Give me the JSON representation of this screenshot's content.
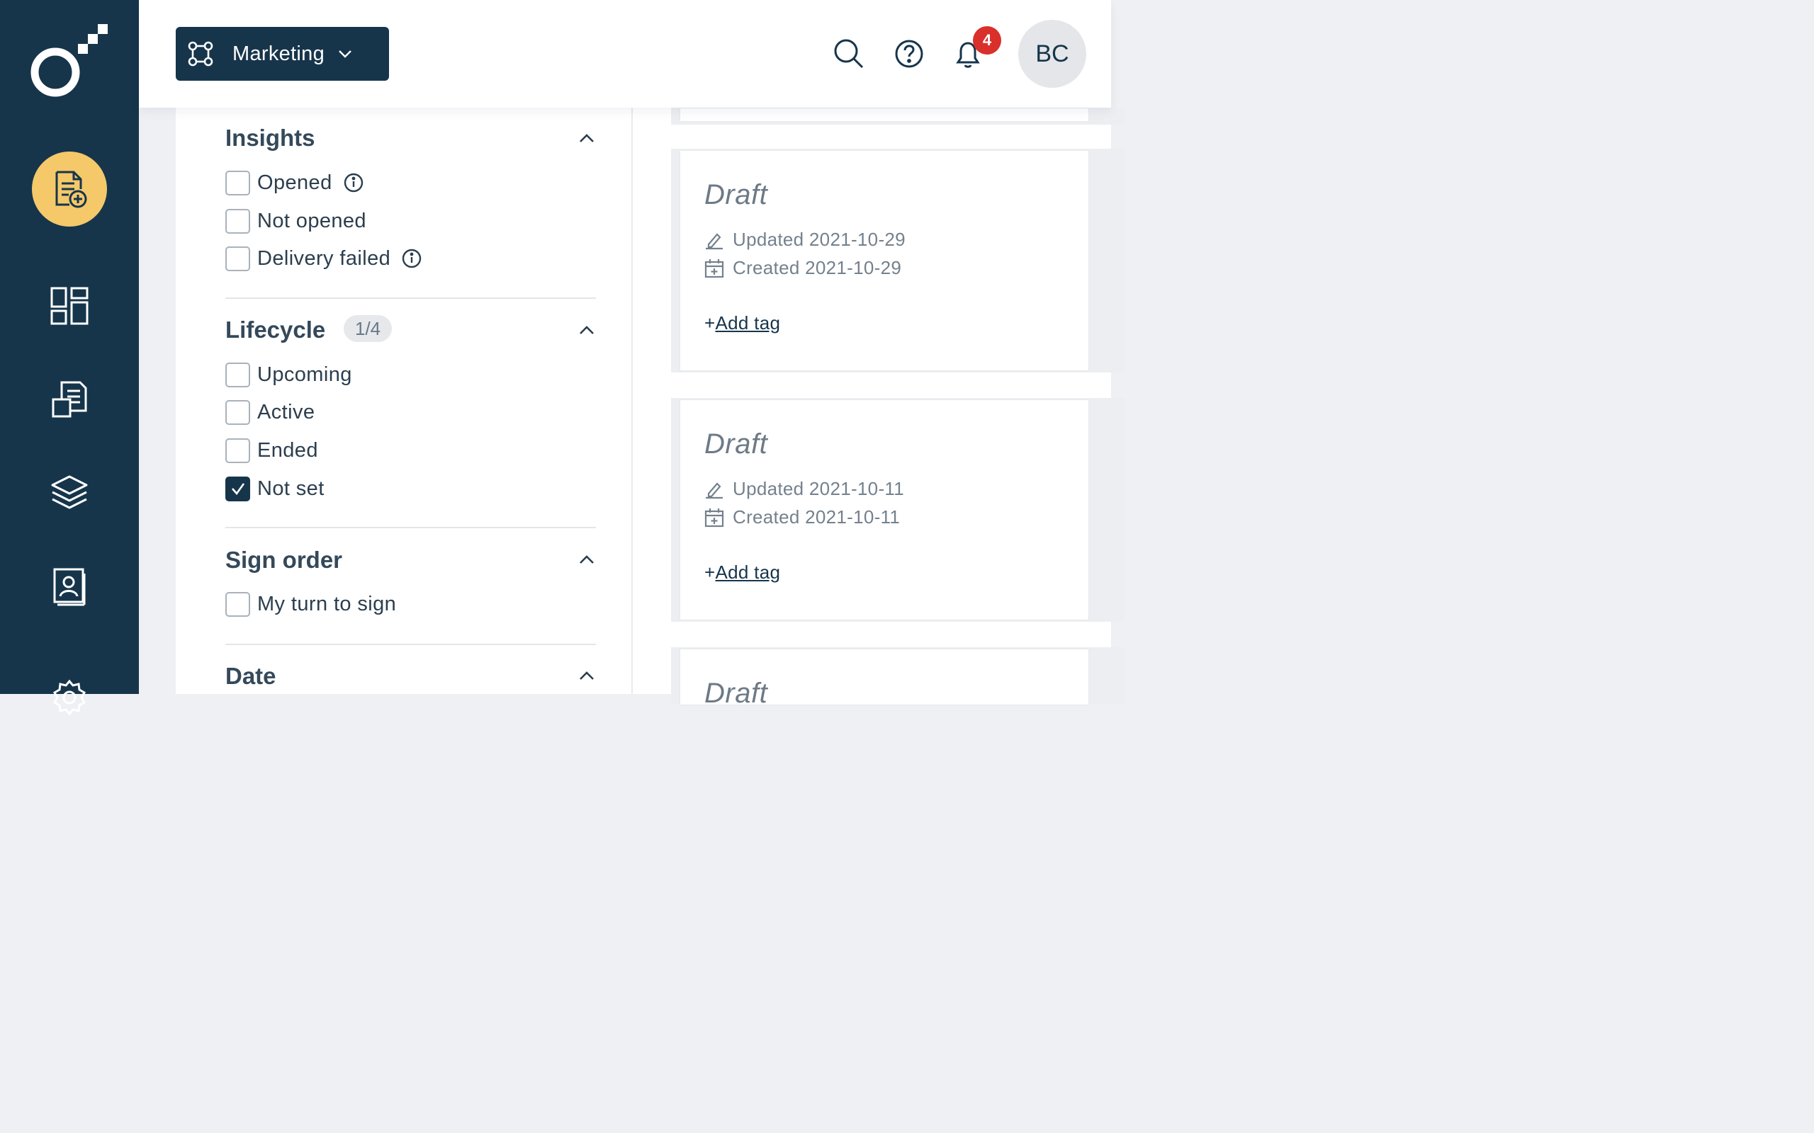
{
  "header": {
    "workspace_label": "Marketing",
    "notification_count": "4",
    "avatar_initials": "BC"
  },
  "sidebar": {
    "items": [
      {
        "name": "create-document",
        "icon": "document-add-icon"
      },
      {
        "name": "dashboard",
        "icon": "dashboard-grid-icon"
      },
      {
        "name": "documents",
        "icon": "documents-icon"
      },
      {
        "name": "templates",
        "icon": "layers-icon"
      },
      {
        "name": "contacts",
        "icon": "contact-book-icon"
      },
      {
        "name": "settings",
        "icon": "gear-icon"
      }
    ],
    "accent_color": "#f5c869",
    "background_color": "#16354b"
  },
  "filters": {
    "insights": {
      "title": "Insights",
      "options": [
        {
          "label": "Opened",
          "checked": false,
          "info": true
        },
        {
          "label": "Not opened",
          "checked": false,
          "info": false
        },
        {
          "label": "Delivery failed",
          "checked": false,
          "info": true
        }
      ]
    },
    "lifecycle": {
      "title": "Lifecycle",
      "count": "1/4",
      "options": [
        {
          "label": "Upcoming",
          "checked": false
        },
        {
          "label": "Active",
          "checked": false
        },
        {
          "label": "Ended",
          "checked": false
        },
        {
          "label": "Not set",
          "checked": true
        }
      ]
    },
    "sign_order": {
      "title": "Sign order",
      "options": [
        {
          "label": "My turn to sign",
          "checked": false
        }
      ]
    },
    "date": {
      "title": "Date"
    }
  },
  "documents": [
    {
      "status": "Draft",
      "updated": "Updated 2021-10-29",
      "created": "Created 2021-10-29",
      "add_tag_plus": "+",
      "add_tag_label": "Add tag"
    },
    {
      "status": "Draft",
      "updated": "Updated 2021-10-11",
      "created": "Created 2021-10-11",
      "add_tag_plus": "+",
      "add_tag_label": "Add tag"
    },
    {
      "status": "Draft"
    }
  ]
}
